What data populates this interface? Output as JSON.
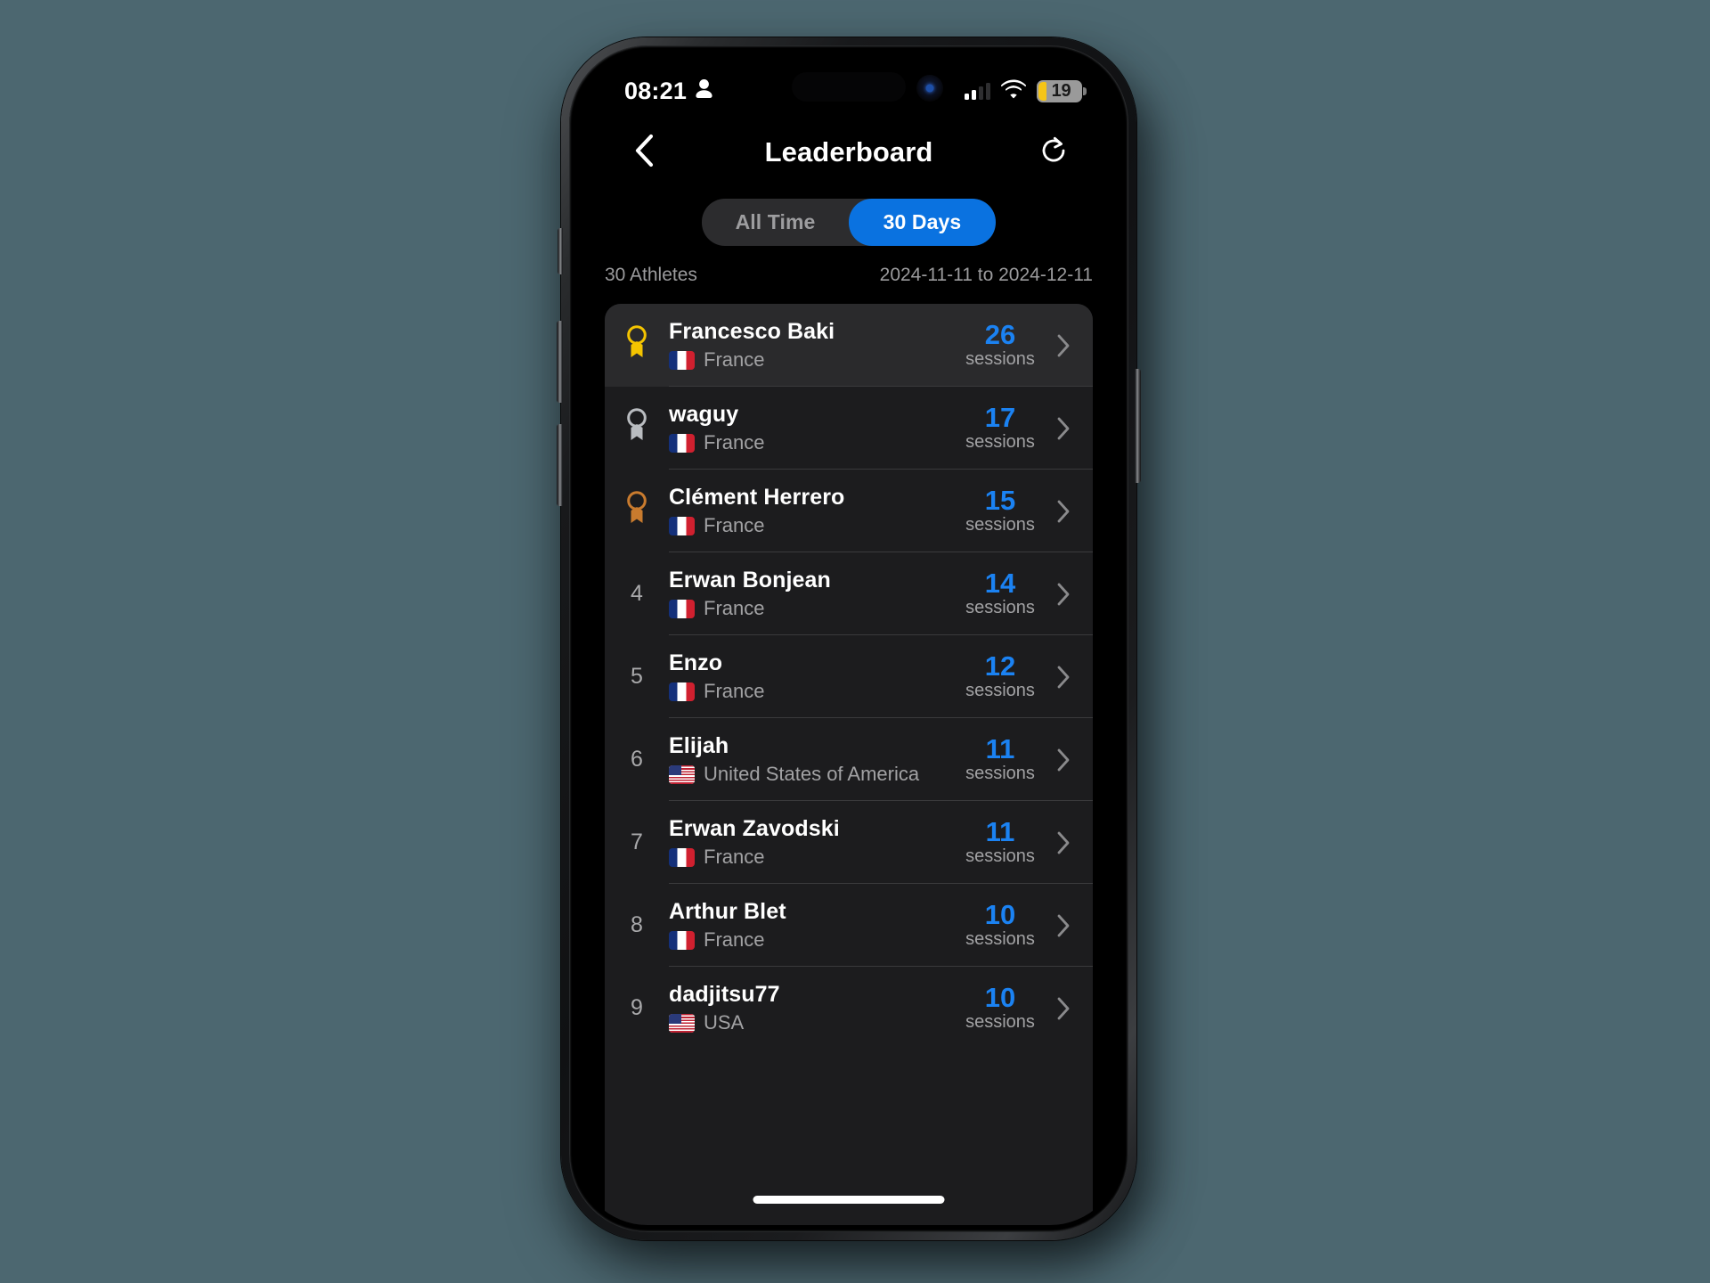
{
  "status_bar": {
    "time": "08:21",
    "person_icon": "person-icon",
    "signal_icon": "cellular-signal-icon",
    "signal_bars_filled": 2,
    "signal_bars_total": 4,
    "wifi_icon": "wifi-icon",
    "battery_icon": "battery-low-icon",
    "battery_percent": "19",
    "battery_color": "#f5c518"
  },
  "nav": {
    "back_icon": "chevron-left-icon",
    "title": "Leaderboard",
    "refresh_icon": "refresh-icon"
  },
  "segmented_control": {
    "options": [
      {
        "label": "All Time",
        "active": false
      },
      {
        "label": "30 Days",
        "active": true
      }
    ],
    "active_color": "#0a72e0",
    "track_color": "#2c2c2e"
  },
  "meta": {
    "athlete_count": "30 Athletes",
    "date_range": "2024-11-11 to 2024-12-11"
  },
  "list": {
    "stat_label": "sessions",
    "accent_color": "#1b82f2",
    "rows": [
      {
        "rank": "1",
        "medal": "gold",
        "medal_icon": "gold-medal-icon",
        "name": "Francesco Baki",
        "country": "France",
        "flag": "fr",
        "sessions": "26",
        "stat_label": "sessions",
        "highlight": true
      },
      {
        "rank": "2",
        "medal": "silver",
        "medal_icon": "silver-medal-icon",
        "name": "waguy",
        "country": "France",
        "flag": "fr",
        "sessions": "17",
        "stat_label": "sessions",
        "highlight": false
      },
      {
        "rank": "3",
        "medal": "bronze",
        "medal_icon": "bronze-medal-icon",
        "name": "Clément Herrero",
        "country": "France",
        "flag": "fr",
        "sessions": "15",
        "stat_label": "sessions",
        "highlight": false
      },
      {
        "rank": "4",
        "medal": null,
        "medal_icon": null,
        "name": "Erwan Bonjean",
        "country": "France",
        "flag": "fr",
        "sessions": "14",
        "stat_label": "sessions",
        "highlight": false
      },
      {
        "rank": "5",
        "medal": null,
        "medal_icon": null,
        "name": "Enzo",
        "country": "France",
        "flag": "fr",
        "sessions": "12",
        "stat_label": "sessions",
        "highlight": false
      },
      {
        "rank": "6",
        "medal": null,
        "medal_icon": null,
        "name": "Elijah",
        "country": "United States of America",
        "flag": "us",
        "sessions": "11",
        "stat_label": "sessions",
        "highlight": false
      },
      {
        "rank": "7",
        "medal": null,
        "medal_icon": null,
        "name": "Erwan Zavodski",
        "country": "France",
        "flag": "fr",
        "sessions": "11",
        "stat_label": "sessions",
        "highlight": false
      },
      {
        "rank": "8",
        "medal": null,
        "medal_icon": null,
        "name": "Arthur Blet",
        "country": "France",
        "flag": "fr",
        "sessions": "10",
        "stat_label": "sessions",
        "highlight": false
      },
      {
        "rank": "9",
        "medal": null,
        "medal_icon": null,
        "name": "dadjitsu77",
        "country": "USA",
        "flag": "us",
        "sessions": "10",
        "stat_label": "sessions",
        "highlight": false
      }
    ]
  },
  "colors": {
    "page_background": "#4c6770",
    "screen_background": "#000000",
    "card_background": "#1c1c1e",
    "card_highlight": "#2a2a2c",
    "medal_gold": "#f4c400",
    "medal_silver": "#b9bcc0",
    "medal_bronze": "#c97b2e"
  }
}
